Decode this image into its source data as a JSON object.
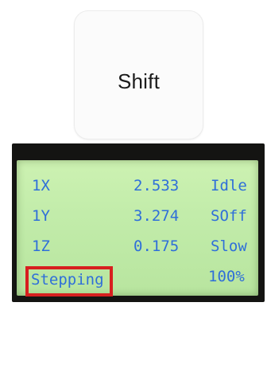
{
  "key": {
    "label": "Shift"
  },
  "lcd": {
    "rows": [
      {
        "axis": "1X",
        "value": "2.533",
        "state": "Idle"
      },
      {
        "axis": "1Y",
        "value": "3.274",
        "state": "SOff"
      },
      {
        "axis": "1Z",
        "value": "0.175",
        "state": "Slow"
      }
    ],
    "footer": {
      "mode": "Stepping",
      "percent": "100%"
    }
  },
  "colors": {
    "lcd_text": "#2f6fd9",
    "highlight_box": "#d71f1f",
    "lcd_background": "#c2ecaa"
  }
}
